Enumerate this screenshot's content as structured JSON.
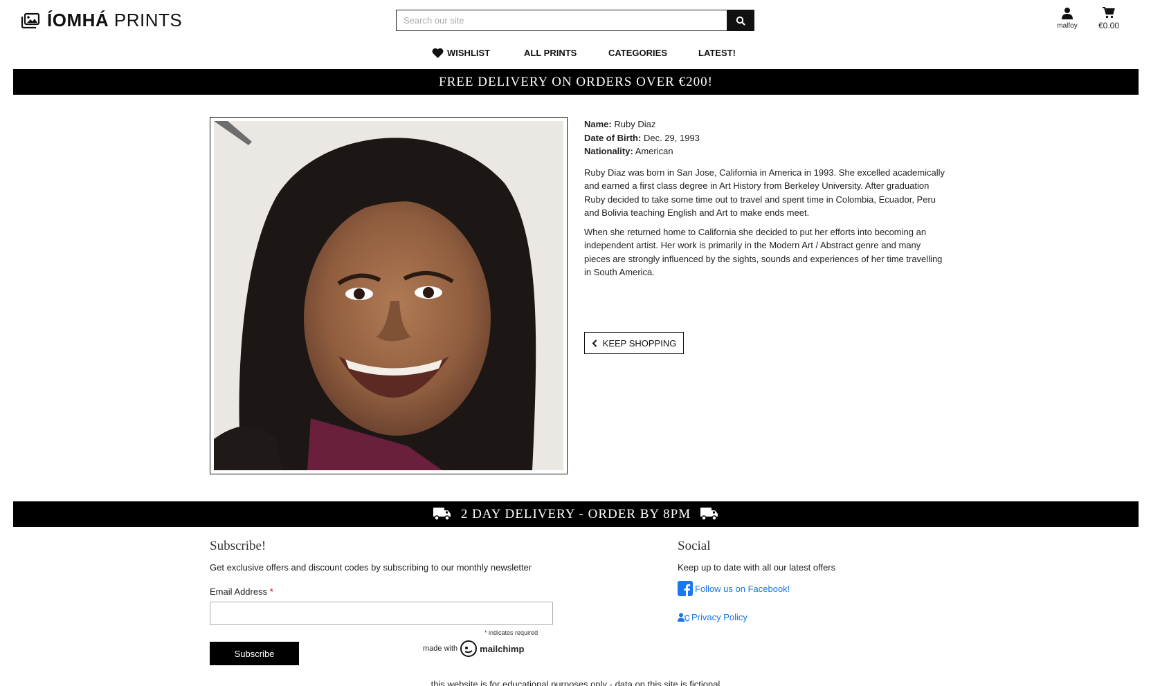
{
  "header": {
    "brand_prefix": "ÍOMHÁ",
    "brand_suffix": " PRINTS",
    "search_placeholder": "Search our site",
    "account_label": "malfoy",
    "cart_total": "€0.00"
  },
  "nav": {
    "items": [
      {
        "label": "WISHLIST"
      },
      {
        "label": "ALL PRINTS"
      },
      {
        "label": "CATEGORIES"
      },
      {
        "label": "LATEST!"
      }
    ]
  },
  "banners": {
    "top": "FREE DELIVERY ON ORDERS OVER €200!",
    "bottom": "2 DAY DELIVERY - ORDER BY 8PM"
  },
  "artist": {
    "name_label": "Name:",
    "name": "Ruby Diaz",
    "dob_label": "Date of Birth:",
    "dob": "Dec. 29, 1993",
    "nationality_label": "Nationality:",
    "nationality": "American",
    "bio_1": "Ruby Diaz was born in San Jose, California in America in 1993. She excelled academically and earned a first class degree in Art History from Berkeley University. After graduation Ruby decided to take some time out to travel and spent time in Colombia, Ecuador, Peru and Bolivia teaching English and Art to make ends meet.",
    "bio_2": "When she returned home to California she decided to put her efforts into becoming an independent artist. Her work is primarily in the Modern Art / Abstract genre and many pieces are strongly influenced by the sights, sounds and experiences of her time travelling in South America.",
    "keep_shopping": "KEEP SHOPPING"
  },
  "footer": {
    "subscribe_title": "Subscribe!",
    "subscribe_text": "Get exclusive offers and discount codes by subscribing to our monthly newsletter",
    "email_label": "Email Address",
    "required_mark": "*",
    "indicates_required": "indicates required",
    "subscribe_button": "Subscribe",
    "made_with": "made with",
    "mailchimp": "mailchimp",
    "social_title": "Social",
    "social_text": "Keep up to date with all our latest offers",
    "facebook_link": "Follow us on Facebook!",
    "privacy_link": "Privacy Policy",
    "disclaimer": "this website is for educational purposes only - data on this site is fictional"
  },
  "colors": {
    "banner_bg": "#000000",
    "link": "#1a73e8",
    "facebook": "#1877f2",
    "required": "#cc0000"
  }
}
